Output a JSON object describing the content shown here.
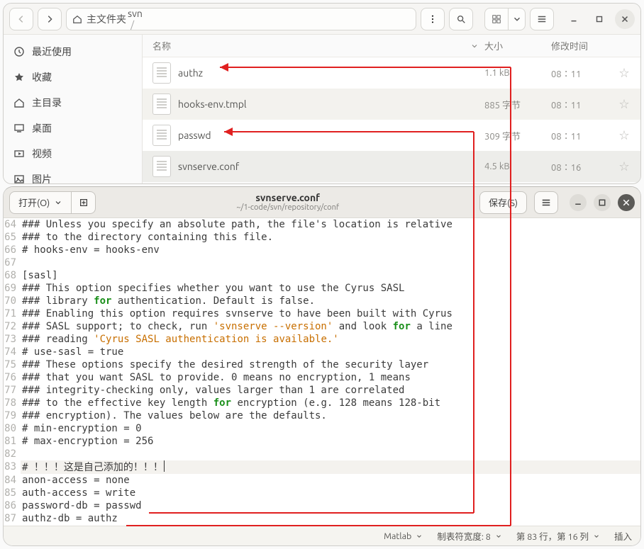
{
  "fileManager": {
    "path": {
      "root": "主文件夹",
      "segs": [
        "1-code",
        "svn",
        "repository",
        "conf"
      ]
    },
    "sidebar": [
      {
        "icon": "clock",
        "label": "最近使用"
      },
      {
        "icon": "star",
        "label": "收藏"
      },
      {
        "icon": "home",
        "label": "主目录"
      },
      {
        "icon": "desk",
        "label": "桌面"
      },
      {
        "icon": "video",
        "label": "视频"
      },
      {
        "icon": "pic",
        "label": "图片"
      }
    ],
    "columns": {
      "name": "名称",
      "size": "大小",
      "mtime": "修改时间"
    },
    "rows": [
      {
        "name": "authz",
        "size": "1.1 kB",
        "mtime": "08∶11",
        "sel": false
      },
      {
        "name": "hooks-env.tmpl",
        "size": "885 字节",
        "mtime": "08∶11",
        "sel": false
      },
      {
        "name": "passwd",
        "size": "309 字节",
        "mtime": "08∶11",
        "sel": false
      },
      {
        "name": "svnserve.conf",
        "size": "4.5 kB",
        "mtime": "08∶16",
        "sel": true
      }
    ]
  },
  "editor": {
    "open_label": "打开(O)",
    "save_label": "保存(S)",
    "title": "svnserve.conf",
    "subtitle": "~/1-code/svn/repository/conf",
    "status": {
      "lang": "Matlab",
      "tabwidth_label": "制表符宽度: 8",
      "pos": "第 83 行，第 16 列",
      "mode": "插入"
    },
    "first_line_no": 64,
    "lines": [
      [
        [
          "comment",
          "### Unless you specify an absolute path, the file's location is relative"
        ]
      ],
      [
        [
          "comment",
          "### to the directory containing this file."
        ]
      ],
      [
        [
          "comment",
          "# hooks-env = hooks-env"
        ]
      ],
      [],
      [
        [
          "plain",
          "[sasl]"
        ]
      ],
      [
        [
          "comment",
          "### This option specifies whether you want to use the Cyrus SASL"
        ]
      ],
      [
        [
          "comment",
          "### library "
        ],
        [
          "kw",
          "for"
        ],
        [
          "comment",
          " authentication. Default is false."
        ]
      ],
      [
        [
          "comment",
          "### Enabling this option requires svnserve to have been built with Cyrus"
        ]
      ],
      [
        [
          "comment",
          "### SASL support; to check, run "
        ],
        [
          "str",
          "'svnserve --version'"
        ],
        [
          "comment",
          " and look "
        ],
        [
          "kw",
          "for"
        ],
        [
          "comment",
          " a line"
        ]
      ],
      [
        [
          "comment",
          "### reading "
        ],
        [
          "str",
          "'Cyrus SASL authentication is available.'"
        ]
      ],
      [
        [
          "comment",
          "# use-sasl = true"
        ]
      ],
      [
        [
          "comment",
          "### These options specify the desired strength of the security layer"
        ]
      ],
      [
        [
          "comment",
          "### that you want SASL to provide. 0 means no encryption, 1 means"
        ]
      ],
      [
        [
          "comment",
          "### integrity-checking only, values larger than 1 are correlated"
        ]
      ],
      [
        [
          "comment",
          "### to the effective key length "
        ],
        [
          "kw",
          "for"
        ],
        [
          "comment",
          " encryption (e.g. 128 means 128-bit"
        ]
      ],
      [
        [
          "comment",
          "### encryption). The values below are the defaults."
        ]
      ],
      [
        [
          "comment",
          "# min-encryption = 0"
        ]
      ],
      [
        [
          "comment",
          "# max-encryption = 256"
        ]
      ],
      [],
      [
        [
          "plain",
          "# ！！！这是自己添加的！！！"
        ],
        [
          "caret",
          ""
        ]
      ],
      [
        [
          "plain",
          "anon-access = none"
        ]
      ],
      [
        [
          "plain",
          "auth-access = write"
        ]
      ],
      [
        [
          "plain",
          "password-db = passwd"
        ]
      ],
      [
        [
          "plain",
          "authz-db = authz"
        ]
      ]
    ],
    "highlight_line_no": 83
  }
}
